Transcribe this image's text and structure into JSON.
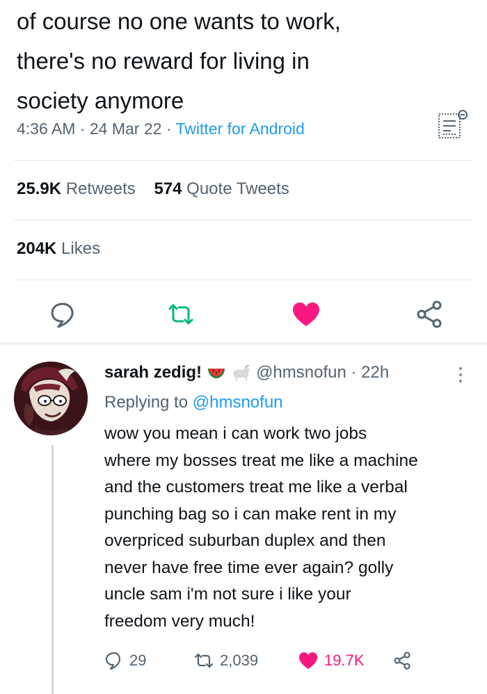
{
  "tweet": {
    "text": "of course no one wants to work,\nthere's no reward for living in\nsociety anymore",
    "time": "4:36 AM",
    "date": "24 Mar 22",
    "separator": "·",
    "source": "Twitter for Android",
    "retweets_count": "25.9K",
    "retweets_label": "Retweets",
    "quotes_count": "574",
    "quotes_label": "Quote Tweets",
    "likes_count": "204K",
    "likes_label": "Likes"
  },
  "actions": {
    "reply_icon": "reply-icon",
    "retweet_icon": "retweet-icon",
    "like_icon": "heart-icon",
    "share_icon": "share-icon",
    "liked_color": "#f91880",
    "retweet_color": "#00ba7c"
  },
  "reply": {
    "name": "sarah zedig!",
    "handle": "@hmsnofun",
    "separator": "·",
    "time_ago": "22h",
    "replying_to_label": "Replying to",
    "replying_to_handle": "@hmsnofun",
    "text": "wow you mean i can work two jobs\nwhere my bosses treat me like a machine\nand the customers treat me like a verbal\npunching bag so i can make rent in my\noverpriced suburban duplex and then\nnever have free time ever again? golly\nuncle sam i'm not sure i like your\nfreedom very much!",
    "reply_count": "29",
    "retweet_count": "2,039",
    "like_count": "19.7K"
  },
  "colors": {
    "link": "#1d9bf0",
    "secondary_text": "#536471",
    "primary_text": "#0f1419"
  }
}
